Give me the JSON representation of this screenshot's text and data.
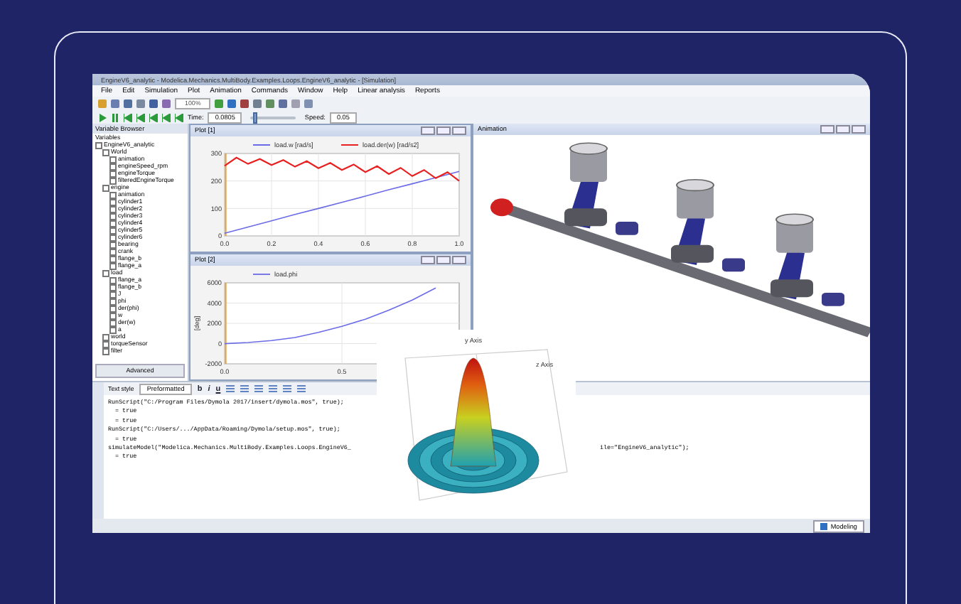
{
  "window": {
    "title": "EngineV6_analytic - Modelica.Mechanics.MultiBody.Examples.Loops.EngineV6_analytic - [Simulation]"
  },
  "menu": [
    "File",
    "Edit",
    "Simulation",
    "Plot",
    "Animation",
    "Commands",
    "Window",
    "Help",
    "Linear analysis",
    "Reports"
  ],
  "toolbar": {
    "zoom": "100%"
  },
  "animation_bar": {
    "time_label": "Time:",
    "time": "0.0805",
    "speed_label": "Speed:",
    "speed": "0.05",
    "slider": {
      "level": 0.05
    }
  },
  "variable_browser": {
    "title": "Variable Browser",
    "header": "Variables",
    "tree": [
      {
        "label": "EngineV6_analytic",
        "children": [
          {
            "label": "World",
            "children": [
              {
                "label": "animation",
                "checked": false
              },
              {
                "label": "engineSpeed_rpm",
                "checked": false
              },
              {
                "label": "engineTorque",
                "checked": false
              },
              {
                "label": "filteredEngineTorque",
                "checked": false
              }
            ]
          },
          {
            "label": "engine",
            "children": [
              {
                "label": "animation",
                "checked": false
              },
              {
                "label": "cylinder1",
                "checked": false
              },
              {
                "label": "cylinder2",
                "checked": false
              },
              {
                "label": "cylinder3",
                "checked": false
              },
              {
                "label": "cylinder4",
                "checked": false
              },
              {
                "label": "cylinder5",
                "checked": false
              },
              {
                "label": "cylinder6",
                "checked": false
              },
              {
                "label": "bearing",
                "checked": false
              },
              {
                "label": "crank",
                "checked": false
              },
              {
                "label": "flange_b",
                "checked": false
              },
              {
                "label": "flange_a",
                "checked": false
              }
            ]
          },
          {
            "label": "load",
            "children": [
              {
                "label": "flange_a",
                "checked": false
              },
              {
                "label": "flange_b",
                "checked": false
              },
              {
                "label": "J",
                "checked": false
              },
              {
                "label": "phi",
                "checked": false
              },
              {
                "label": "der(phi)",
                "checked": false
              },
              {
                "label": "w",
                "checked": false
              },
              {
                "label": "der(w)",
                "checked": false
              },
              {
                "label": "a",
                "checked": false
              }
            ]
          },
          {
            "label": "world",
            "checked": false
          },
          {
            "label": "torqueSensor",
            "checked": false
          },
          {
            "label": "filter",
            "checked": false
          }
        ]
      }
    ],
    "advanced_button": "Advanced"
  },
  "plots": [
    {
      "title": "Plot [1]",
      "chart_data": {
        "type": "line",
        "grid": true,
        "legend": true,
        "x": [
          0,
          0.1,
          0.2,
          0.3,
          0.4,
          0.5,
          0.6,
          0.7,
          0.8,
          0.9,
          1.0
        ],
        "xlim": [
          0,
          1
        ],
        "ylim": [
          0,
          300
        ],
        "xticks": [
          {
            "value": 0,
            "label": "0.0"
          },
          {
            "value": 0.2,
            "label": "0.2"
          },
          {
            "value": 0.4,
            "label": "0.4"
          },
          {
            "value": 0.6,
            "label": "0.6"
          },
          {
            "value": 0.8,
            "label": "0.8"
          },
          {
            "value": 1,
            "label": "1.0"
          }
        ],
        "yticks": [
          0,
          100,
          200,
          300
        ],
        "series": [
          {
            "name": "load.w [rad/s]",
            "color": "#6b6be8",
            "values": [
              10,
              32,
              55,
              78,
              100,
              122,
              145,
              168,
              190,
              212,
              235
            ]
          },
          {
            "name": "load.der(w) [rad/s2]",
            "color": "#e82020",
            "x": [
              0,
              0.05,
              0.1,
              0.15,
              0.2,
              0.25,
              0.3,
              0.35,
              0.4,
              0.45,
              0.5,
              0.55,
              0.6,
              0.65,
              0.7,
              0.75,
              0.8,
              0.85,
              0.9,
              0.95,
              1.0
            ],
            "values": [
              255,
              285,
              262,
              280,
              258,
              276,
              252,
              272,
              246,
              266,
              240,
              260,
              232,
              254,
              225,
              248,
              218,
              240,
              210,
              232,
              200
            ]
          }
        ]
      }
    },
    {
      "title": "Plot [2]",
      "chart_data": {
        "type": "line",
        "grid": true,
        "legend": true,
        "x": [
          0,
          0.1,
          0.2,
          0.3,
          0.4,
          0.5,
          0.6,
          0.7,
          0.8,
          0.9
        ],
        "xlim": [
          0,
          1
        ],
        "ylim": [
          -2000,
          6000
        ],
        "ylabel": "[deg]",
        "xticks": [
          {
            "value": 0,
            "label": "0.0"
          },
          {
            "value": 0.5,
            "label": "0.5"
          }
        ],
        "yticks": [
          -2000,
          0,
          2000,
          4000,
          6000
        ],
        "series": [
          {
            "name": "load.phi",
            "color": "#6b6be8",
            "values": [
              0,
              100,
              300,
              600,
              1100,
              1700,
              2400,
              3300,
              4300,
              5500
            ]
          }
        ]
      }
    }
  ],
  "animation_window": {
    "title": "Animation"
  },
  "surface_plot": {
    "axis_labels": [
      "y Axis",
      "z Axis"
    ]
  },
  "command_log": {
    "text_style_label": "Text style",
    "style": "Preformatted",
    "format_buttons": [
      "b",
      "i",
      "u"
    ],
    "lines": [
      {
        "text": "RunScript(\"C:/Program Files/Dymola 2017/insert/dymola.mos\", true);"
      },
      {
        "text": "  = true"
      },
      {
        "text": "  = true"
      },
      {
        "text": "RunScript(\"C:/Users/.../AppData/Roaming/Dymola/setup.mos\", true);"
      },
      {
        "text": "  = true"
      },
      {
        "text": "simulateModel(\"Modelica.Mechanics.MultiBody.Examples.Loops.EngineV6_",
        "tail": "ile=\"EngineV6_analytic\");"
      },
      {
        "text": "  = true"
      }
    ]
  },
  "status_bar": {
    "mode_button": "Modeling"
  }
}
